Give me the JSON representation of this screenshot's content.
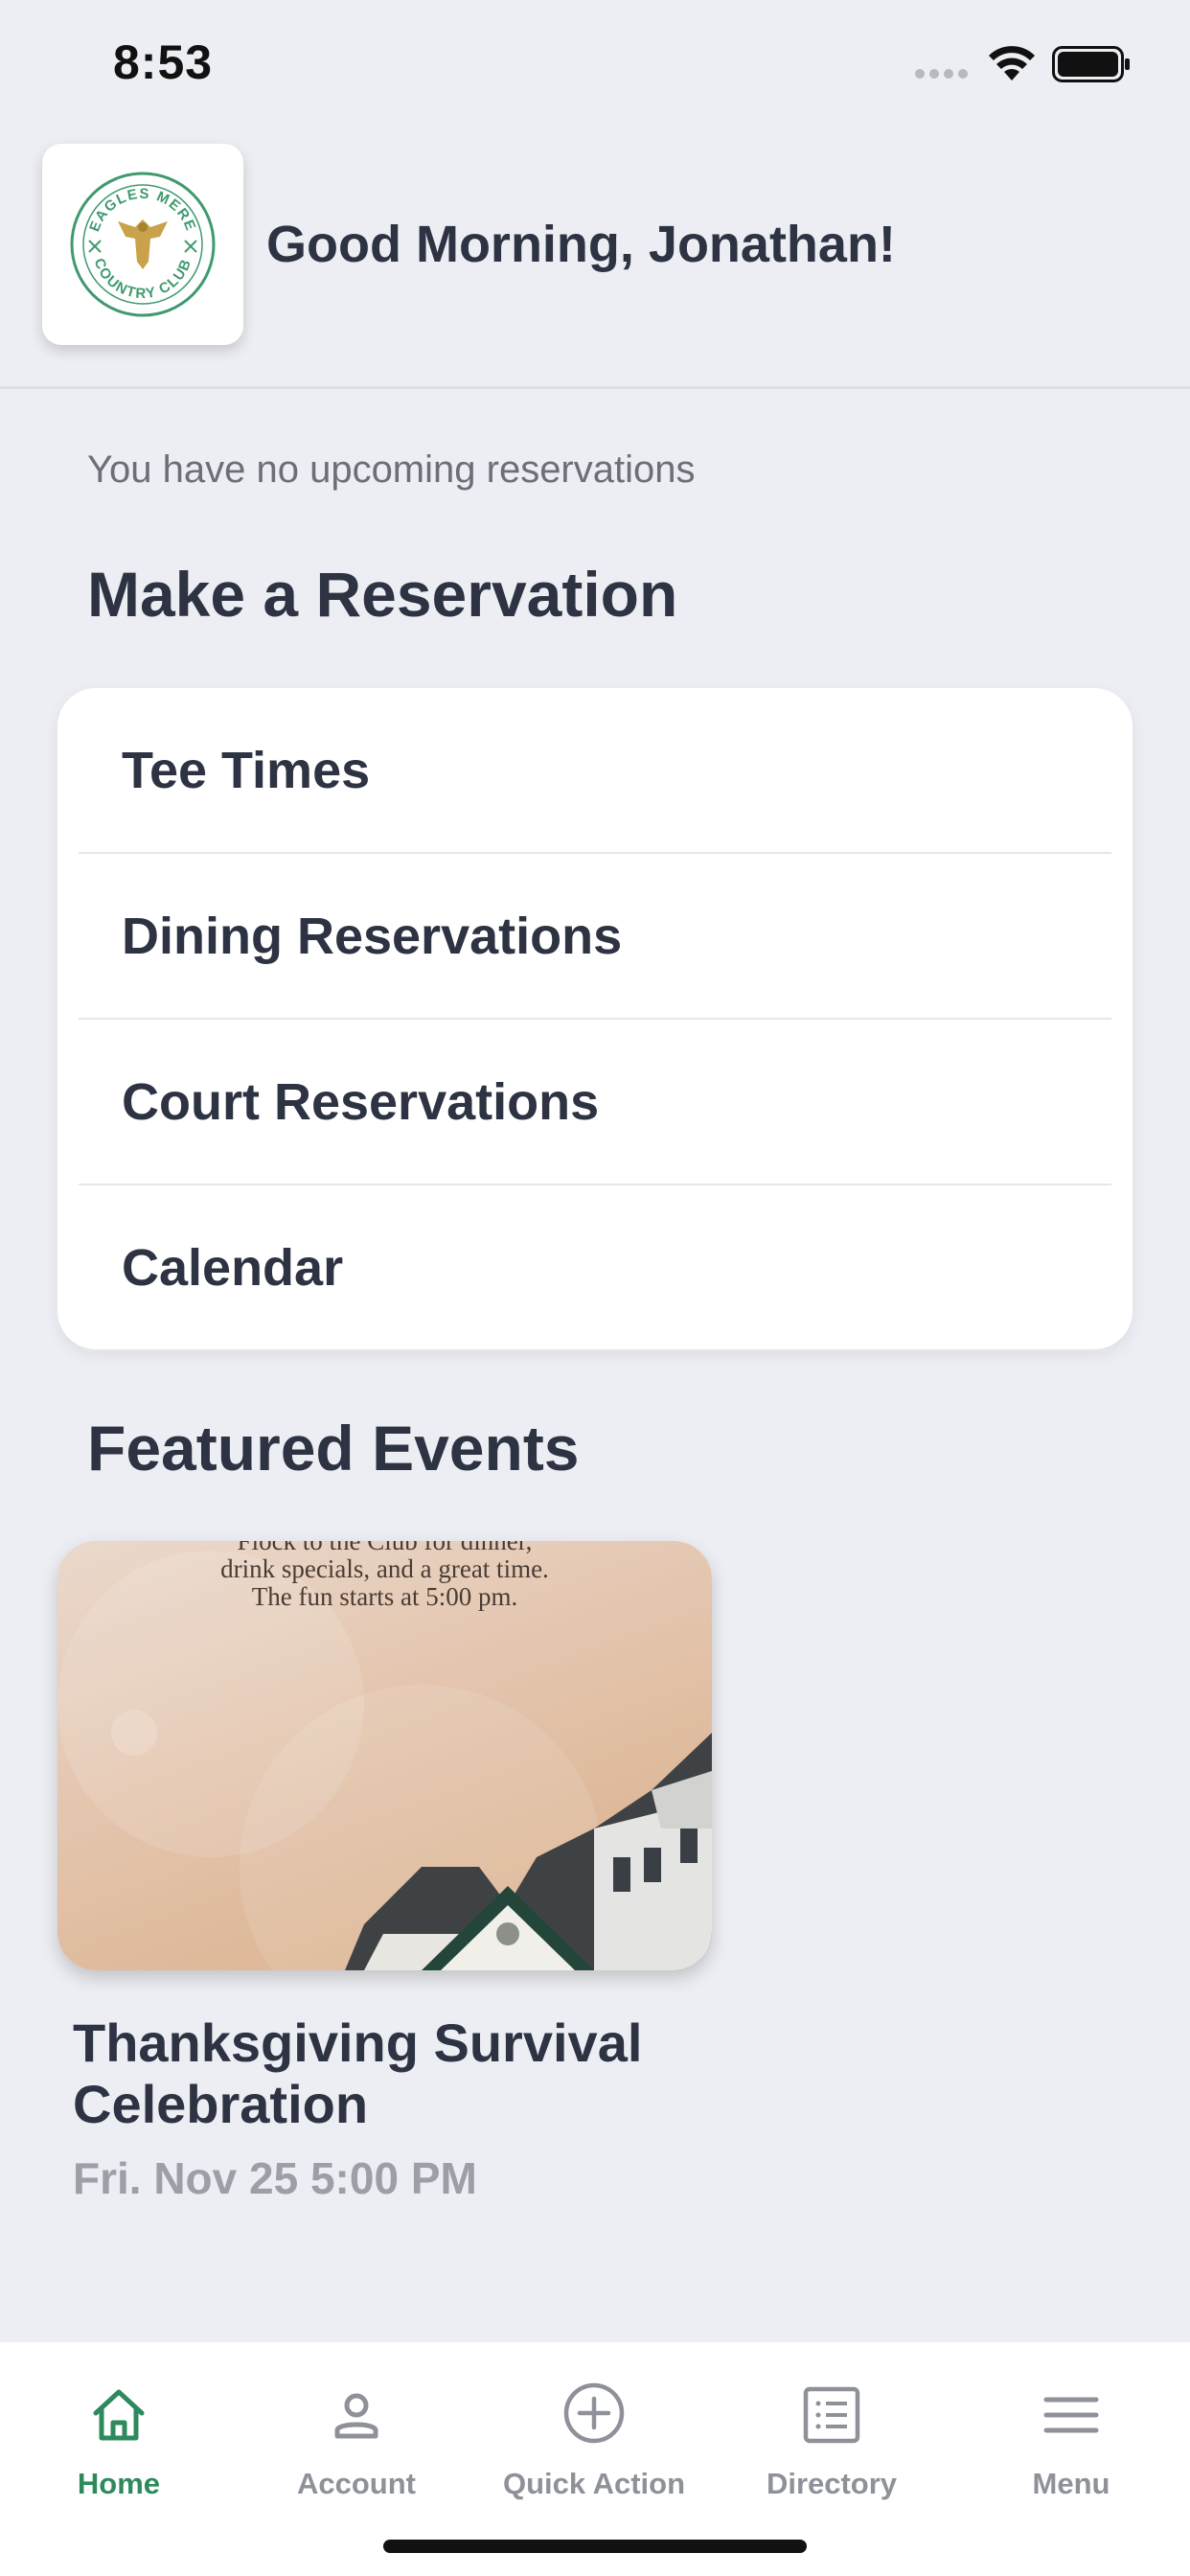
{
  "status_bar": {
    "time": "8:53"
  },
  "header": {
    "greeting": "Good Morning, Jonathan!",
    "logo": {
      "top_text": "EAGLES MERE",
      "bottom_text": "COUNTRY CLUB"
    }
  },
  "reservations": {
    "empty_message": "You have no upcoming reservations",
    "section_title": "Make a Reservation",
    "items": [
      {
        "label": "Tee Times"
      },
      {
        "label": "Dining Reservations"
      },
      {
        "label": "Court Reservations"
      },
      {
        "label": "Calendar"
      }
    ]
  },
  "featured": {
    "section_title": "Featured Events",
    "event": {
      "image_text": [
        "Flock to the Club for dinner,",
        "drink specials, and a great time.",
        "The fun starts at 5:00 pm."
      ],
      "title": "Thanksgiving Survival Celebration",
      "date": "Fri. Nov 25 5:00 PM"
    }
  },
  "tab_bar": {
    "tabs": [
      {
        "label": "Home",
        "icon": "home-icon",
        "active": true
      },
      {
        "label": "Account",
        "icon": "person-icon",
        "active": false
      },
      {
        "label": "Quick Action",
        "icon": "plus-circle-icon",
        "active": false
      },
      {
        "label": "Directory",
        "icon": "list-icon",
        "active": false
      },
      {
        "label": "Menu",
        "icon": "hamburger-icon",
        "active": false
      }
    ]
  },
  "colors": {
    "accent": "#2e8a5d",
    "background": "#eceef3",
    "text": "#2d3342",
    "muted": "#9c9fa7"
  }
}
